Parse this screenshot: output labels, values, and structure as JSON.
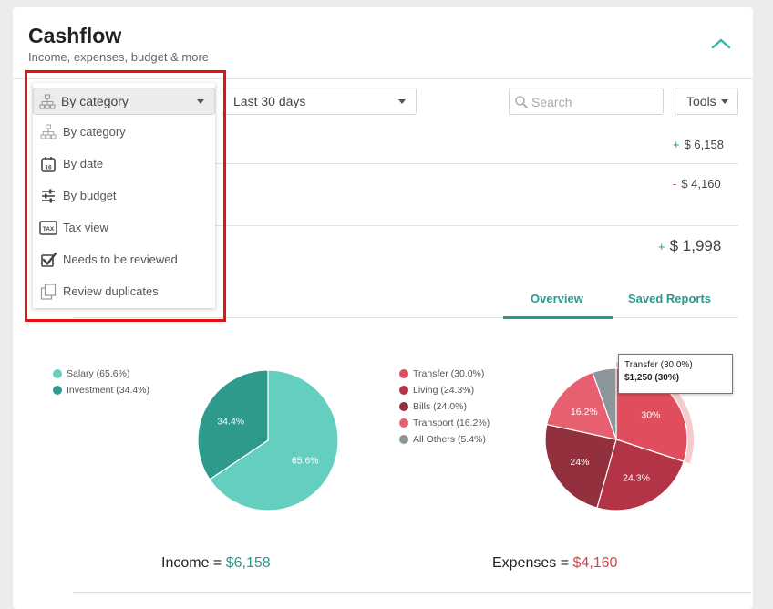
{
  "header": {
    "title": "Cashflow",
    "subtitle": "Income, expenses, budget & more"
  },
  "filters": {
    "view_selected": "By category",
    "period_selected": "Last 30 days",
    "search_placeholder": "Search",
    "tools_label": "Tools"
  },
  "view_menu": {
    "items": [
      {
        "label": "By category",
        "icon": "category-tree-icon"
      },
      {
        "label": "By date",
        "icon": "calendar-icon"
      },
      {
        "label": "By budget",
        "icon": "sliders-icon"
      },
      {
        "label": "Tax view",
        "icon": "tax-icon"
      },
      {
        "label": "Needs to be reviewed",
        "icon": "checkbox-checked-icon"
      },
      {
        "label": "Review duplicates",
        "icon": "duplicate-icon"
      }
    ]
  },
  "summary": {
    "income": {
      "sign": "+",
      "value": "$ 6,158"
    },
    "expenses": {
      "sign": "-",
      "value": "$ 4,160"
    },
    "net": {
      "sign": "+",
      "value": "$ 1,998"
    }
  },
  "tabs": {
    "overview": "Overview",
    "saved_reports": "Saved Reports"
  },
  "income_chart": {
    "legend": [
      {
        "label": "Salary (65.6%)",
        "color": "#64cfbf"
      },
      {
        "label": "Investment (34.4%)",
        "color": "#2e9a8c"
      }
    ],
    "total_label": "Income =",
    "total_value": "$6,158",
    "total_color": "#2a9a8d"
  },
  "expense_chart": {
    "legend": [
      {
        "label": "Transfer (30.0%)",
        "color": "#e04e5e"
      },
      {
        "label": "Living (24.3%)",
        "color": "#b23446"
      },
      {
        "label": "Bills (24.0%)",
        "color": "#92303d"
      },
      {
        "label": "Transport (16.2%)",
        "color": "#e66070"
      },
      {
        "label": "All Others (5.4%)",
        "color": "#8c959a"
      }
    ],
    "tooltip_line1": "Transfer (30.0%)",
    "tooltip_line2": "$1,250 (30%)",
    "total_label": "Expenses =",
    "total_value": "$4,160",
    "total_color": "#d9414f"
  },
  "chart_data": [
    {
      "type": "pie",
      "categories": [
        "Salary",
        "Investment"
      ],
      "values": [
        65.6,
        34.4
      ],
      "slice_labels": [
        "65.6%",
        "34.4%"
      ],
      "colors": [
        "#64cfbf",
        "#2e9a8c"
      ],
      "legend_position": "left"
    },
    {
      "type": "pie",
      "categories": [
        "Transfer",
        "Living",
        "Bills",
        "Transport",
        "All Others"
      ],
      "values": [
        30.0,
        24.3,
        24.0,
        16.2,
        5.4
      ],
      "slice_labels": [
        "30%",
        "24.3%",
        "24%",
        "16.2%",
        ""
      ],
      "colors": [
        "#e04e5e",
        "#b23446",
        "#92303d",
        "#e66070",
        "#8c959a"
      ],
      "legend_position": "left",
      "highlighted": "Transfer"
    }
  ]
}
